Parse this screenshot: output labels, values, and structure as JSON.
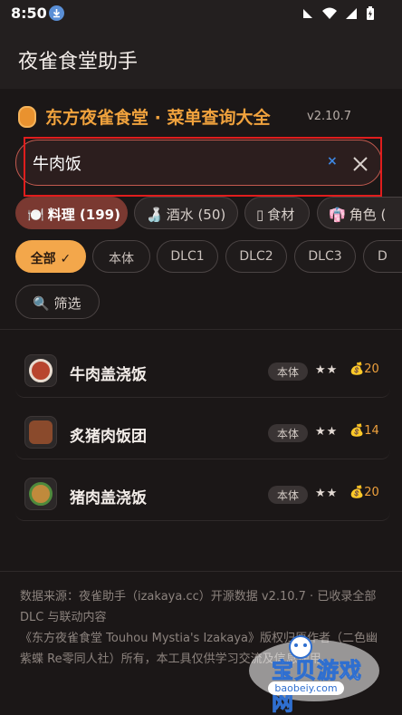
{
  "status_bar": {
    "time": "8:50"
  },
  "app_bar": {
    "title": "夜雀食堂助手"
  },
  "header": {
    "title": "东方夜雀食堂 · 菜单查询大全",
    "version": "v2.10.7"
  },
  "search": {
    "value": "牛肉饭",
    "clear_label": "×"
  },
  "category_tabs": [
    {
      "icon": "🍽️",
      "label": "料理 (199)"
    },
    {
      "icon": "🍶",
      "label": "酒水 (50)"
    },
    {
      "icon": "▯",
      "label": "食材"
    },
    {
      "icon": "👘",
      "label": "角色 ("
    }
  ],
  "filter_chips": [
    {
      "label": "全部 ✓"
    },
    {
      "label": "本体"
    },
    {
      "label": "DLC1"
    },
    {
      "label": "DLC2"
    },
    {
      "label": "DLC3"
    },
    {
      "label": "D"
    }
  ],
  "filter_button": {
    "icon": "🔍",
    "label": "筛选"
  },
  "results": [
    {
      "name": "牛肉盖浇饭",
      "badge": "本体",
      "stars": "★★",
      "coin_icon": "💰",
      "price": "20",
      "dish_color": "#b8452e"
    },
    {
      "name": "炙猪肉饭团",
      "badge": "本体",
      "stars": "★★",
      "coin_icon": "💰",
      "price": "14",
      "dish_color": "#8a4a2c"
    },
    {
      "name": "猪肉盖浇饭",
      "badge": "本体",
      "stars": "★★",
      "coin_icon": "💰",
      "price": "20",
      "dish_color": "#c08a3c"
    }
  ],
  "footer": {
    "line1": "数据来源：夜雀助手（izakaya.cc）开源数据 v2.10.7 · 已收录全部 DLC 与联动内容",
    "line2": "《东方夜雀食堂 Touhou Mystia's Izakaya》版权归原作者（二色幽紫蝶 Re零同人社）所有，本工具仅供学习交流及信息使用。"
  },
  "watermark": {
    "text": "宝贝游戏网",
    "url": "baobeiy.com"
  },
  "colors": {
    "accent": "#f0a23d",
    "active_tab": "#7a3931",
    "highlight": "#e01d1d",
    "background": "#1b1717"
  }
}
